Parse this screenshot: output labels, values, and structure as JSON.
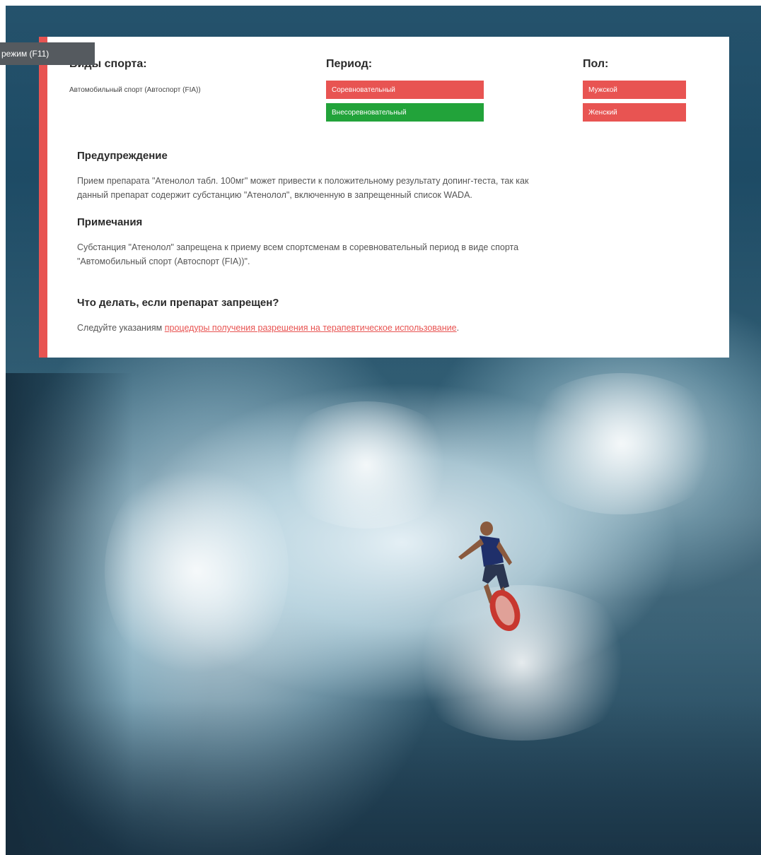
{
  "tooltip": {
    "text": "режим (F11)"
  },
  "sports": {
    "title": "Виды спорта:",
    "value": "Автомобильный спорт (Автоспорт (FIA))"
  },
  "period": {
    "title": "Период:",
    "options": [
      {
        "label": "Соревновательный",
        "color": "#e85452"
      },
      {
        "label": "Внесоревновательный",
        "color": "#22a33a"
      }
    ]
  },
  "gender": {
    "title": "Пол:",
    "options": [
      {
        "label": "Мужской",
        "color": "#e85452"
      },
      {
        "label": "Женский",
        "color": "#e85452"
      }
    ]
  },
  "warning": {
    "title": "Предупреждение",
    "line1": "Прием препарата \"Атенолол табл. 100мг\" может привести к положительному результату допинг-теста, так как",
    "line2": "данный препарат содержит субстанцию \"Атенолол\", включенную в запрещенный список WADA."
  },
  "notes": {
    "title": "Примечания",
    "line1": "Субстанция \"Атенолол\" запрещена к приему всем спортсменам в соревновательный период в виде спорта",
    "line2": "\"Автомобильный спорт (Автоспорт (FIA))\"."
  },
  "whatToDo": {
    "title": "Что делать, если препарат запрещен?",
    "prefix": "Следуйте указаниям ",
    "link": "процедуры получения разрешения на терапевтическое использование",
    "suffix": "."
  },
  "colors": {
    "accent": "#e85452",
    "green": "#22a33a"
  }
}
